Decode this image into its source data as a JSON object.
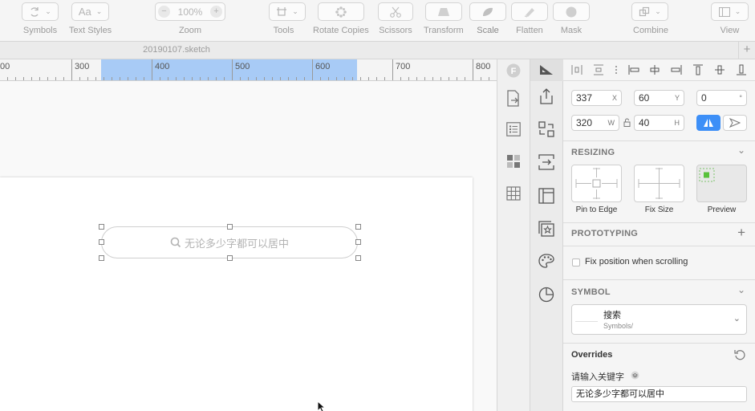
{
  "toolbar": {
    "symbols_label": "Symbols",
    "text_styles_label": "Text Styles",
    "text_styles_glyph": "Aa",
    "zoom_label": "Zoom",
    "zoom_value": "100%",
    "zoom_minus": "−",
    "zoom_plus": "+",
    "tools_label": "Tools",
    "rotate_copies_label": "Rotate Copies",
    "scissors_label": "Scissors",
    "transform_label": "Transform",
    "scale_label": "Scale",
    "flatten_label": "Flatten",
    "mask_label": "Mask",
    "combine_label": "Combine",
    "view_label": "View"
  },
  "tabbar": {
    "document_name": "20190107.sketch",
    "add": "+"
  },
  "ruler": {
    "labels": [
      "00",
      "300",
      "400",
      "500",
      "600",
      "700",
      "800"
    ]
  },
  "canvas": {
    "search_placeholder": "无论多少字都可以居中"
  },
  "inspector": {
    "x": "337",
    "x_unit": "X",
    "y": "60",
    "y_unit": "Y",
    "rotation": "0",
    "rotation_unit": "°",
    "w": "320",
    "w_unit": "W",
    "h": "40",
    "h_unit": "H",
    "resizing": {
      "title": "RESIZING",
      "pin_to_edge": "Pin to Edge",
      "fix_size": "Fix Size",
      "preview": "Preview"
    },
    "prototyping": {
      "title": "PROTOTYPING",
      "fix_position": "Fix position when scrolling"
    },
    "symbol": {
      "title": "SYMBOL",
      "name": "搜索",
      "path": "Symbols/"
    },
    "overrides": {
      "title": "Overrides",
      "field_label": "请输入关键字",
      "field_value": "无论多少字都可以居中"
    }
  },
  "colors": {
    "accent": "#3d8ff7",
    "ruler_selection": "#a8cbf6",
    "handle_border": "#888888",
    "preview_green": "#59c13c"
  }
}
